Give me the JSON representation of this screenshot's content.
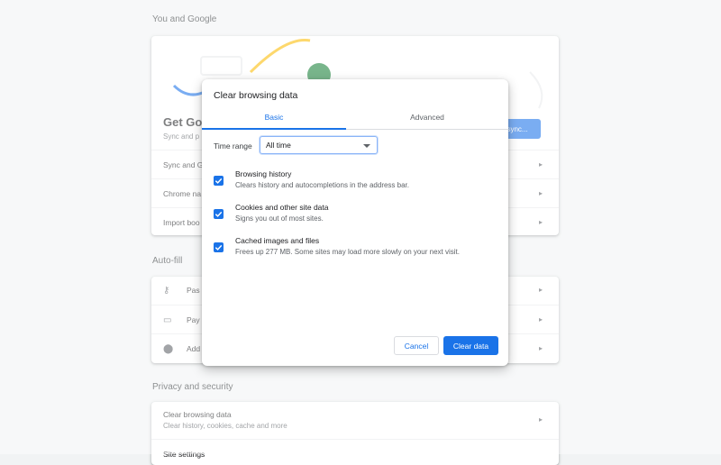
{
  "sections": {
    "you_and_google": "You and Google",
    "autofill": "Auto-fill",
    "privacy": "Privacy and security"
  },
  "you_and_google_card": {
    "get_google": "Get Goo",
    "sync_para": "Sync and p",
    "sync_button": "sync...",
    "rows": [
      "Sync and G",
      "Chrome na",
      "Import boo"
    ]
  },
  "autofill_card": {
    "rows": [
      "Pas",
      "Pay",
      "Add"
    ]
  },
  "privacy_card": {
    "clear_title": "Clear browsing data",
    "clear_sub": "Clear history, cookies, cache and more",
    "site_settings": "Site settings"
  },
  "dialog": {
    "title": "Clear browsing data",
    "tabs": [
      "Basic",
      "Advanced"
    ],
    "time_range_label": "Time range",
    "time_range_value": "All time",
    "options": [
      {
        "title": "Browsing history",
        "desc": "Clears history and autocompletions in the address bar.",
        "checked": true
      },
      {
        "title": "Cookies and other site data",
        "desc": "Signs you out of most sites.",
        "checked": true
      },
      {
        "title": "Cached images and files",
        "desc": "Frees up 277 MB. Some sites may load more slowly on your next visit.",
        "checked": true
      }
    ],
    "cancel": "Cancel",
    "clear": "Clear data"
  },
  "colors": {
    "accent": "#1a73e8",
    "background": "#f1f3f4"
  }
}
